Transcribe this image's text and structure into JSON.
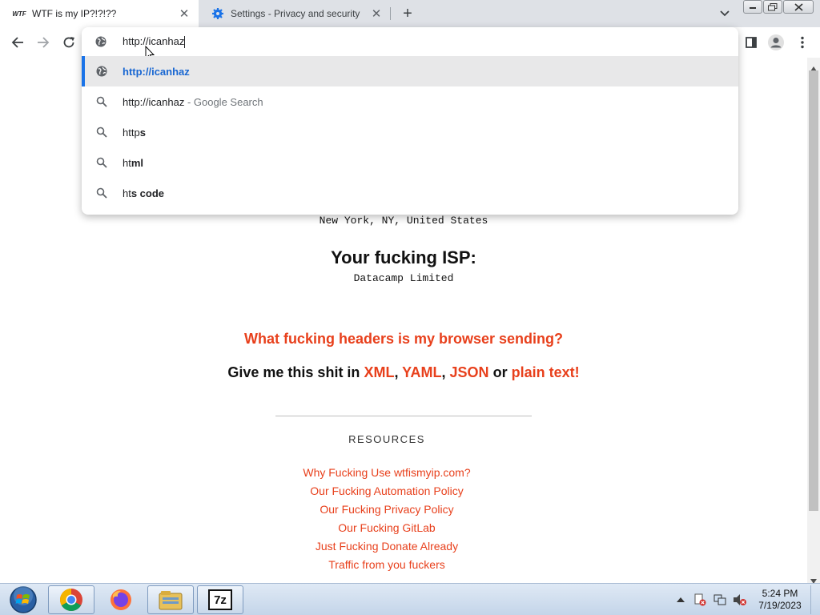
{
  "tabs": [
    {
      "favicon_text": "WTF",
      "title": "WTF is my IP?!?!??"
    },
    {
      "title": "Settings - Privacy and security"
    }
  ],
  "omnibox": {
    "typed_value": "http://icanhaz",
    "suggestions": [
      {
        "icon": "globe-icon",
        "bold": "http://icanhaz",
        "rest": "",
        "suffix": ""
      },
      {
        "icon": "search-icon",
        "plain": "http://icanhaz",
        "bold": "",
        "suffix": " - Google Search"
      },
      {
        "icon": "search-icon",
        "plain": "http",
        "bold": "s",
        "suffix": ""
      },
      {
        "icon": "search-icon",
        "plain": "ht",
        "bold": "ml",
        "suffix": ""
      },
      {
        "icon": "search-icon",
        "plain": "ht",
        "bold": "s code",
        "suffix": ""
      }
    ]
  },
  "page": {
    "location": "New York, NY, United States",
    "isp_heading": "Your fucking ISP:",
    "isp_value": "Datacamp Limited",
    "headers_link": "What fucking headers is my browser sending?",
    "format_prefix": "Give me this shit in",
    "formats": [
      "XML",
      "YAML",
      "JSON"
    ],
    "format_or": "or",
    "format_plain": "plain text!",
    "resources_heading": "RESOURCES",
    "resource_links": [
      "Why Fucking Use wtfismyip.com?",
      "Our Fucking Automation Policy",
      "Our Fucking Privacy Policy",
      "Our Fucking GitLab",
      "Just Fucking Donate Already",
      "Traffic from you fuckers"
    ]
  },
  "taskbar": {
    "clock_time": "5:24 PM",
    "clock_date": "7/19/2023",
    "apps": [
      "chrome-icon",
      "firefox-icon",
      "file-explorer-icon",
      "7zip-icon"
    ],
    "zip_label": "7z"
  },
  "colors": {
    "accent_red": "#e8401c",
    "selection_blue": "#1a73e8"
  }
}
